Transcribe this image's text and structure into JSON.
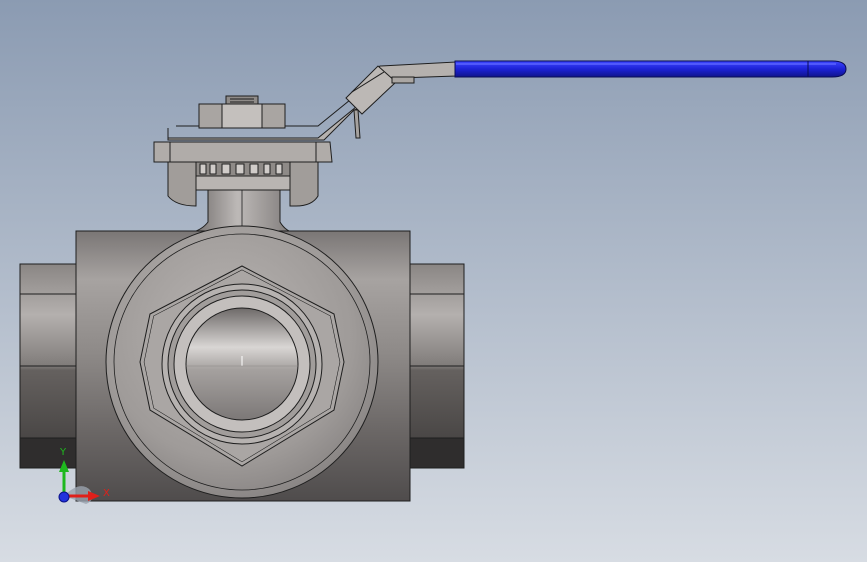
{
  "viewport": {
    "background_top": "#8b9bb2",
    "background_bottom": "#d7dce3"
  },
  "model": {
    "body_color": "#8f8b89",
    "body_dark": "#5f5c5b",
    "edge_color": "#1e1e1e",
    "handle_grip_color": "#1d22d6",
    "handle_grip_highlight": "#5a63ff",
    "handle_metal": "#b9b5b2"
  },
  "triad": {
    "x_label": "X",
    "y_label": "Y",
    "x_color": "#e0201a",
    "y_color": "#1eb81e",
    "z_color": "#2233dd"
  }
}
